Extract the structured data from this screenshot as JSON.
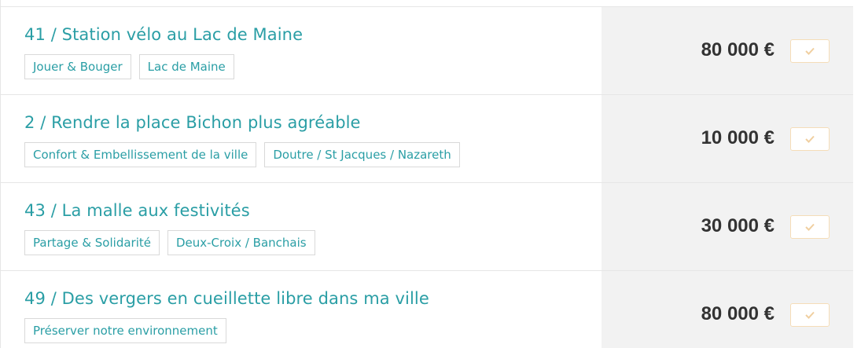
{
  "projects": [
    {
      "title": "41 / Station vélo au Lac de Maine",
      "tags": [
        "Jouer & Bouger",
        "Lac de Maine"
      ],
      "price": "80 000 €"
    },
    {
      "title": "2 / Rendre la place Bichon plus agréable",
      "tags": [
        "Confort & Embellissement de la ville",
        "Doutre / St Jacques / Nazareth"
      ],
      "price": "10 000 €"
    },
    {
      "title": "43 / La malle aux festivités",
      "tags": [
        "Partage & Solidarité",
        "Deux-Croix / Banchais"
      ],
      "price": "30 000 €"
    },
    {
      "title": "49 / Des vergers en cueillette libre dans ma ville",
      "tags": [
        "Préserver notre environnement"
      ],
      "price": "80 000 €"
    }
  ],
  "icons": {
    "select_button": "check-icon"
  },
  "colors": {
    "accent": "#2a9ea5",
    "price_text": "#333333",
    "price_panel": "#f2f2f2",
    "check_button_border": "#f5ddb8",
    "check_icon": "#f0cfa0"
  }
}
